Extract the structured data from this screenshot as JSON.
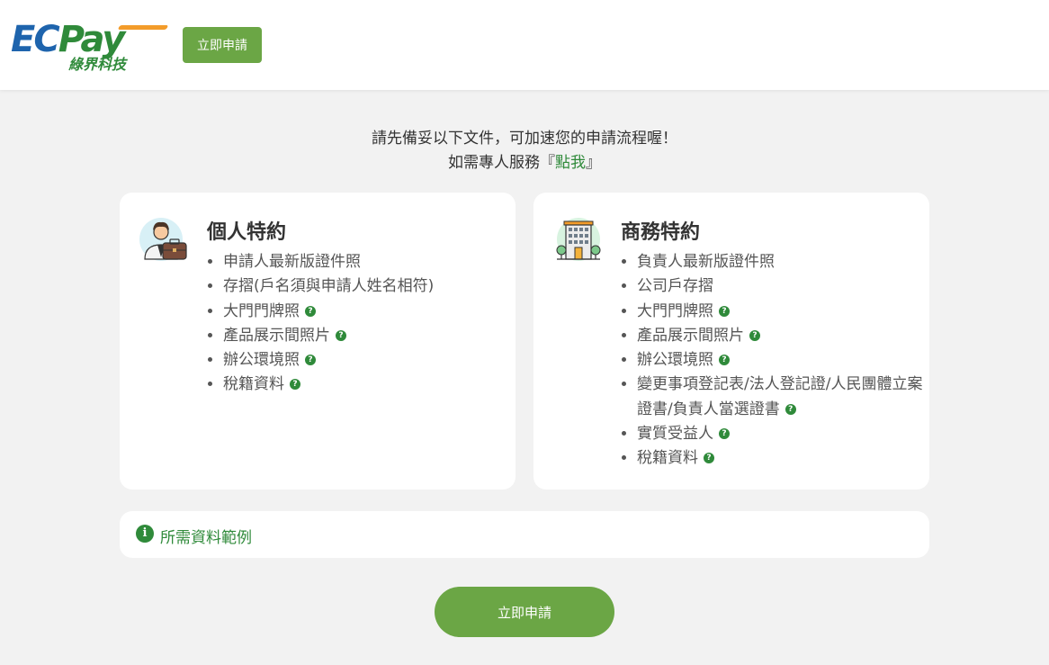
{
  "header": {
    "logo_main_ec": "EC",
    "logo_main_pay": "Pay",
    "logo_sub": "綠界科技",
    "apply_label": "立即申請"
  },
  "intro": {
    "line1": "請先備妥以下文件，可加速您的申請流程喔！",
    "line2_prefix": "如需專人服務『",
    "line2_link": "點我",
    "line2_suffix": "』"
  },
  "personal": {
    "title": "個人特約",
    "icon": "businessman-icon",
    "items": [
      {
        "label": "申請人最新版證件照",
        "help": false
      },
      {
        "label": "存摺(戶名須與申請人姓名相符)",
        "help": false
      },
      {
        "label": "大門門牌照",
        "help": true
      },
      {
        "label": "產品展示間照片",
        "help": true
      },
      {
        "label": "辦公環境照",
        "help": true
      },
      {
        "label": "稅籍資料",
        "help": true
      }
    ]
  },
  "business": {
    "title": "商務特約",
    "icon": "office-building-icon",
    "items": [
      {
        "label": "負責人最新版證件照",
        "help": false
      },
      {
        "label": "公司戶存摺",
        "help": false
      },
      {
        "label": "大門門牌照",
        "help": true
      },
      {
        "label": "產品展示間照片",
        "help": true
      },
      {
        "label": "辦公環境照",
        "help": true
      },
      {
        "label": "變更事項登記表/法人登記證/人民團體立案證書/負責人當選證書",
        "help": true
      },
      {
        "label": "實質受益人",
        "help": true
      },
      {
        "label": "稅籍資料",
        "help": true
      }
    ]
  },
  "help_glyph": "?",
  "info": {
    "icon_glyph": "i",
    "label": "所需資料範例"
  },
  "footer": {
    "apply_label": "立即申請"
  },
  "colors": {
    "brand_green": "#6ba645",
    "link_green": "#2f8a3a",
    "brand_blue": "#1e64ad",
    "accent_orange": "#f39c2a"
  }
}
